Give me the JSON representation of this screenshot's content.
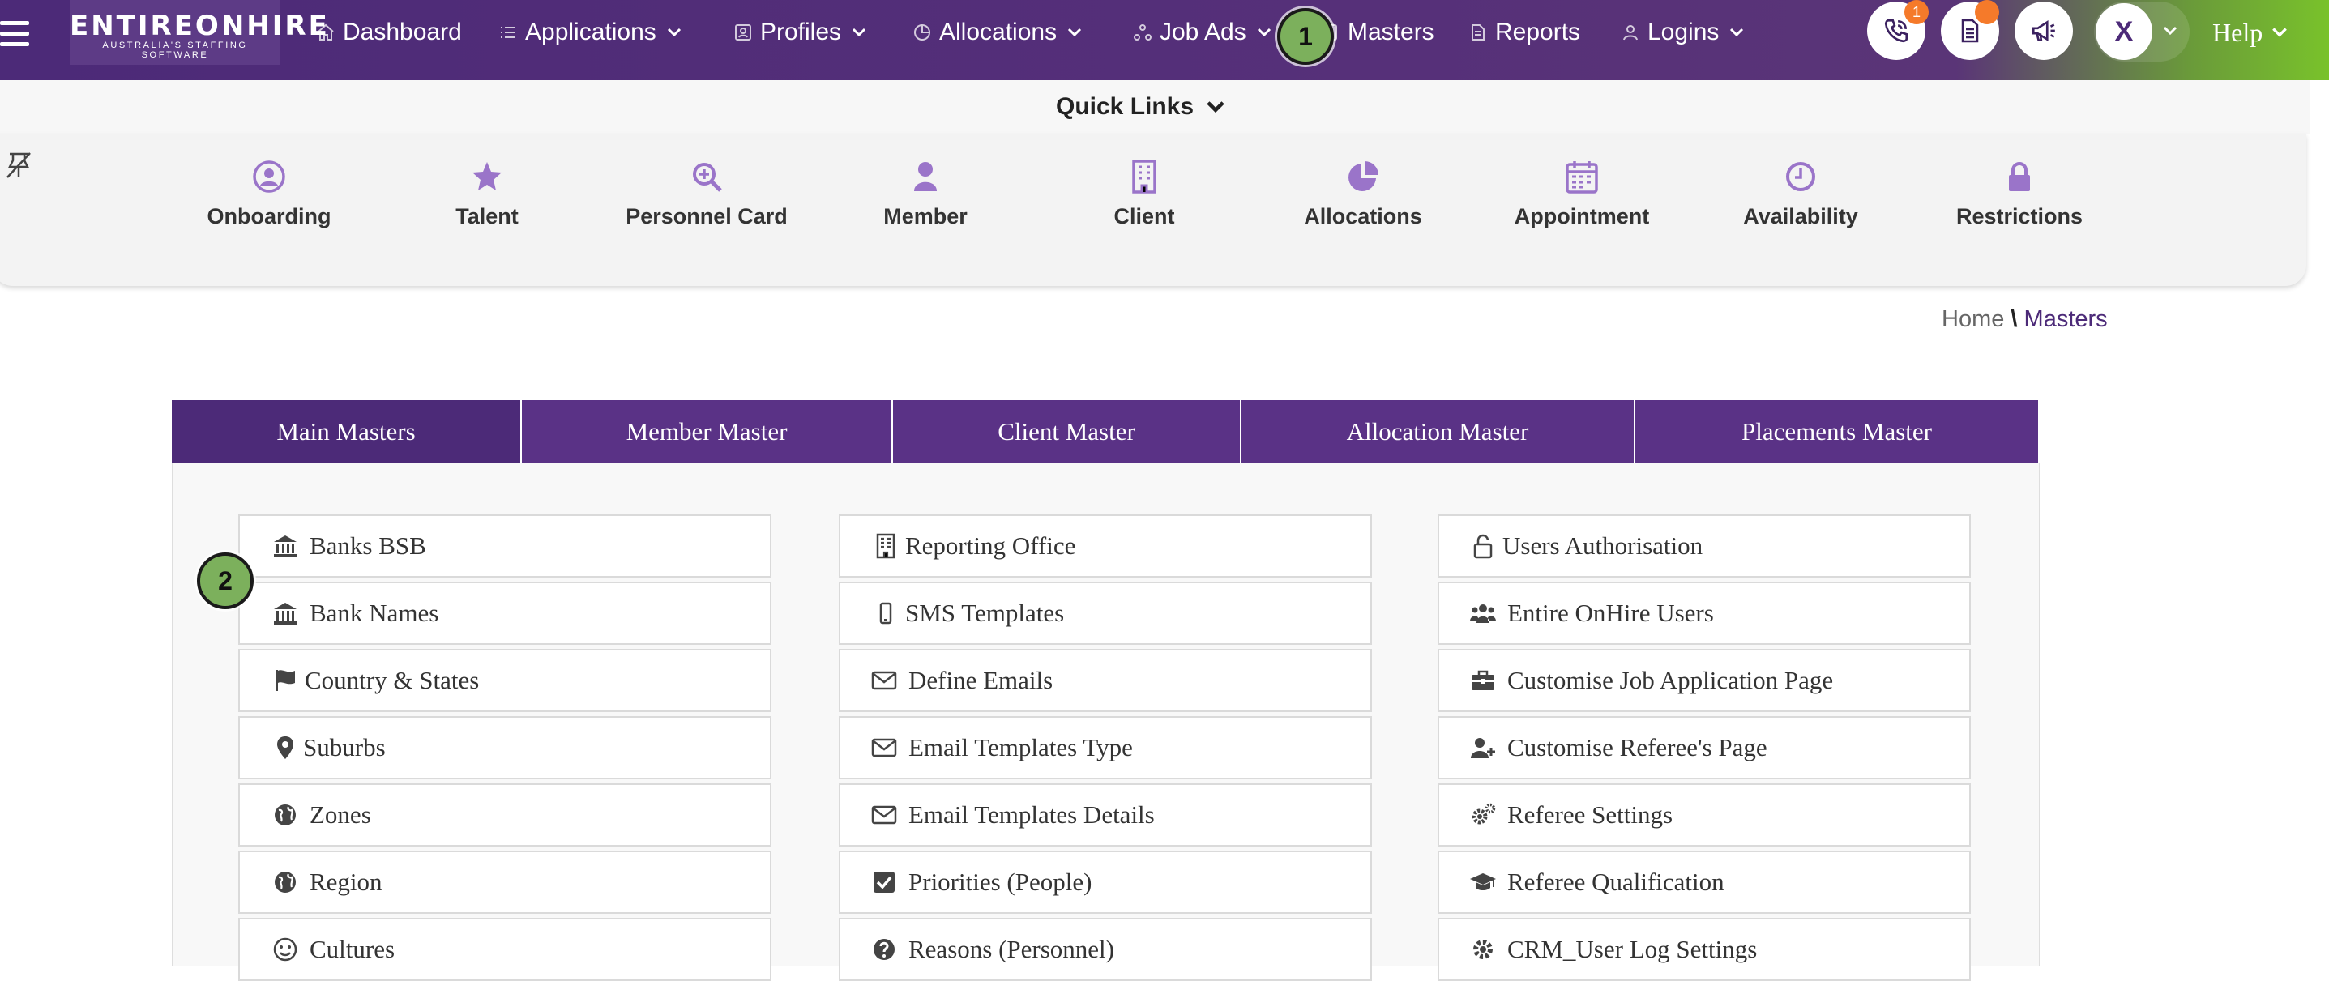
{
  "brand": {
    "name": "ENTIREONHIRE",
    "tagline": "AUSTRALIA'S STAFFING SOFTWARE"
  },
  "nav": {
    "items": [
      {
        "label": "Dashboard",
        "icon": "home-icon",
        "dropdown": false
      },
      {
        "label": "Applications",
        "icon": "list-icon",
        "dropdown": true
      },
      {
        "label": "Profiles",
        "icon": "id-card-icon",
        "dropdown": true
      },
      {
        "label": "Allocations",
        "icon": "pie-chart-icon",
        "dropdown": true
      },
      {
        "label": "Job Ads",
        "icon": "share-nodes-icon",
        "dropdown": true
      },
      {
        "label": "Masters",
        "icon": "square-icon",
        "dropdown": false
      },
      {
        "label": "Reports",
        "icon": "file-icon",
        "dropdown": false
      },
      {
        "label": "Logins",
        "icon": "user-icon",
        "dropdown": true
      }
    ],
    "phone_badge": "1",
    "avatar_initial": "X",
    "help_label": "Help"
  },
  "steps": {
    "one": "1",
    "two": "2"
  },
  "quick_links": {
    "title": "Quick Links",
    "items": [
      {
        "label": "Onboarding",
        "icon": "user-circle-icon"
      },
      {
        "label": "Talent",
        "icon": "star-icon"
      },
      {
        "label": "Personnel Card",
        "icon": "search-plus-icon"
      },
      {
        "label": "Member",
        "icon": "user-icon"
      },
      {
        "label": "Client",
        "icon": "building-icon"
      },
      {
        "label": "Allocations",
        "icon": "pie-chart-icon"
      },
      {
        "label": "Appointment",
        "icon": "calendar-icon"
      },
      {
        "label": "Availability",
        "icon": "clock-icon"
      },
      {
        "label": "Restrictions",
        "icon": "lock-icon"
      }
    ]
  },
  "breadcrumb": {
    "home": "Home",
    "separator": "\\",
    "current": "Masters"
  },
  "tabs": [
    "Main Masters",
    "Member Master",
    "Client Master",
    "Allocation Master",
    "Placements Master"
  ],
  "masters": {
    "col1": [
      {
        "label": "Banks BSB",
        "icon": "bank-icon"
      },
      {
        "label": "Bank Names",
        "icon": "bank-icon"
      },
      {
        "label": "Country & States",
        "icon": "flag-icon"
      },
      {
        "label": "Suburbs",
        "icon": "map-marker-icon"
      },
      {
        "label": "Zones",
        "icon": "globe-icon"
      },
      {
        "label": "Region",
        "icon": "globe-icon"
      },
      {
        "label": "Cultures",
        "icon": "smile-icon"
      }
    ],
    "col2": [
      {
        "label": "Reporting Office",
        "icon": "building-icon"
      },
      {
        "label": "SMS Templates",
        "icon": "mobile-icon"
      },
      {
        "label": "Define Emails",
        "icon": "envelope-icon"
      },
      {
        "label": "Email Templates Type",
        "icon": "envelope-icon"
      },
      {
        "label": "Email Templates Details",
        "icon": "envelope-icon"
      },
      {
        "label": "Priorities (People)",
        "icon": "checkbox-icon"
      },
      {
        "label": "Reasons (Personnel)",
        "icon": "question-circle-icon"
      }
    ],
    "col3": [
      {
        "label": "Users Authorisation",
        "icon": "unlock-icon"
      },
      {
        "label": "Entire OnHire Users",
        "icon": "users-icon"
      },
      {
        "label": "Customise Job Application Page",
        "icon": "briefcase-icon"
      },
      {
        "label": "Customise Referee's Page",
        "icon": "user-plus-icon"
      },
      {
        "label": "Referee Settings",
        "icon": "cogs-icon"
      },
      {
        "label": "Referee Qualification",
        "icon": "graduation-cap-icon"
      },
      {
        "label": "CRM_User Log Settings",
        "icon": "gear-icon"
      }
    ]
  },
  "colors": {
    "brand_purple": "#4c2a78",
    "tab_purple": "#5a3286",
    "accent_green": "#79c22b",
    "badge_orange": "#f57a2a",
    "icon_lavender": "#9a74c9"
  }
}
